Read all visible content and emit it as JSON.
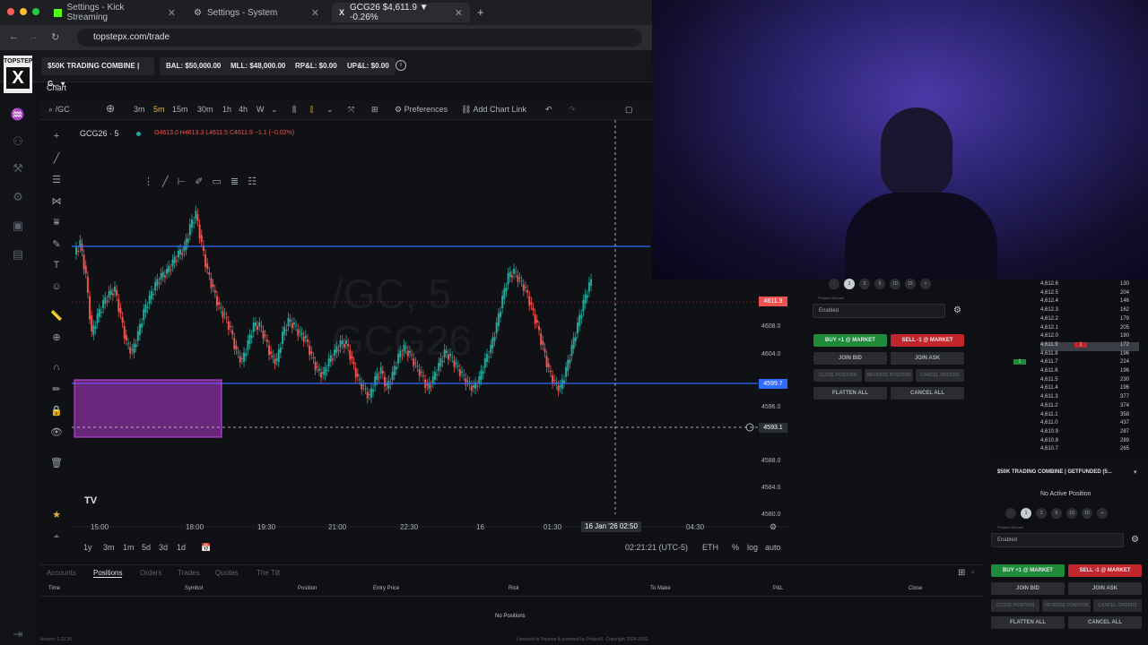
{
  "browser": {
    "tabs": [
      {
        "label": "Settings - Kick Streaming",
        "icon": "kick-icon"
      },
      {
        "label": "Settings - System",
        "icon": "gear-icon"
      },
      {
        "label": "GCG26 $4,611.9 ▼ -0.26%",
        "icon": "topstep-icon"
      }
    ],
    "url": "topstepx.com/trade"
  },
  "app": {
    "logo_top": "TOPSTEP",
    "logo_letter": "X",
    "account_select": "$50K TRADING COMBINE | G...",
    "bal": "BAL: $50,000.00",
    "mll": "MLL: $48,000.00",
    "rpl": "RP&L: $0.00",
    "upl": "UP&L: $0.00"
  },
  "chart_panel": {
    "label": "Chart",
    "symbol_search": "/GC",
    "timeframes": [
      "3m",
      "5m",
      "15m",
      "30m",
      "1h",
      "4h",
      "W"
    ],
    "active_timeframe": "5m",
    "preferences": "Preferences",
    "add_chart_link": "Add Chart Link",
    "legend_symbol": "GCG26 · 5",
    "legend_ohlc": "O4613.0 H4613.3 L4611.5 C4611.9 −1.1 (−0.02%)",
    "watermark_line1": "/GC, 5",
    "watermark_line2": "GCG26",
    "price_axis": [
      "4608.0",
      "4604.0",
      "4596.0",
      "4588.0",
      "4584.0",
      "4580.0"
    ],
    "price_tags": {
      "current": "4611.9",
      "blue": "4599.7",
      "crosshair": "4593.1"
    },
    "time_axis": [
      "15:00",
      "18:00",
      "19:30",
      "21:00",
      "22:30",
      "16",
      "01:30",
      "04:30"
    ],
    "crosshair_time": "16 Jan '26  02:50",
    "ranges": [
      "1y",
      "3m",
      "1m",
      "5d",
      "3d",
      "1d"
    ],
    "clock": "02:21:21 (UTC-5)",
    "session": "ETH",
    "pct": "%",
    "log": "log",
    "auto": "auto",
    "colors": {
      "up": "#26a69a",
      "down": "#ef5350",
      "level": "#2f6bff",
      "zone": "#b23ad1"
    }
  },
  "order_panel": {
    "qty_buttons": [
      "1",
      "3",
      "5",
      "10",
      "15"
    ],
    "bracket_label": "Position Bracket",
    "bracket_value": "Enabled",
    "buy_market": "BUY +1 @ MARKET",
    "sell_market": "SELL -1 @ MARKET",
    "join_bid": "JOIN BID",
    "join_ask": "JOIN ASK",
    "close_position": "CLOSE POSITION",
    "reverse_position": "REVERSE POSITION",
    "cancel_orders": "CANCEL ORDERS",
    "flatten_all": "FLATTEN ALL",
    "cancel_all": "CANCEL ALL"
  },
  "ladder": {
    "rows": [
      {
        "price": "4,612.6",
        "vol": "130",
        "bid": "",
        "ask": ""
      },
      {
        "price": "4,612.5",
        "vol": "204",
        "bid": "",
        "ask": ""
      },
      {
        "price": "4,612.4",
        "vol": "146",
        "bid": "",
        "ask": ""
      },
      {
        "price": "4,612.3",
        "vol": "162",
        "bid": "",
        "ask": ""
      },
      {
        "price": "4,612.2",
        "vol": "179",
        "bid": "",
        "ask": ""
      },
      {
        "price": "4,612.1",
        "vol": "205",
        "bid": "",
        "ask": ""
      },
      {
        "price": "4,612.0",
        "vol": "190",
        "bid": "",
        "ask": ""
      },
      {
        "price": "4,611.9",
        "vol": "172",
        "bid": "",
        "ask": "1"
      },
      {
        "price": "4,611.8",
        "vol": "196",
        "bid": "",
        "ask": ""
      },
      {
        "price": "4,611.7",
        "vol": "224",
        "bid": "1",
        "ask": ""
      },
      {
        "price": "4,611.6",
        "vol": "196",
        "bid": "",
        "ask": ""
      },
      {
        "price": "4,611.5",
        "vol": "230",
        "bid": "",
        "ask": ""
      },
      {
        "price": "4,611.4",
        "vol": "196",
        "bid": "",
        "ask": ""
      },
      {
        "price": "4,611.3",
        "vol": "377",
        "bid": "",
        "ask": ""
      },
      {
        "price": "4,611.2",
        "vol": "374",
        "bid": "",
        "ask": ""
      },
      {
        "price": "4,611.1",
        "vol": "358",
        "bid": "",
        "ask": ""
      },
      {
        "price": "4,611.0",
        "vol": "437",
        "bid": "",
        "ask": ""
      },
      {
        "price": "4,610.9",
        "vol": "287",
        "bid": "",
        "ask": ""
      },
      {
        "price": "4,610.8",
        "vol": "289",
        "bid": "",
        "ask": ""
      },
      {
        "price": "4,610.7",
        "vol": "265",
        "bid": "",
        "ask": ""
      }
    ]
  },
  "account2": {
    "title": "$50K TRADING COMBINE | GETFUNDED (5...",
    "no_position": "No Active Position"
  },
  "positions": {
    "tabs": [
      "Accounts",
      "Positions",
      "Orders",
      "Trades",
      "Quotes",
      "The Tilt"
    ],
    "active_tab": "Positions",
    "columns": [
      "Time",
      "Symbol",
      "Position",
      "Entry Price",
      "Risk",
      "To Make",
      "P&L",
      "Close"
    ],
    "empty": "No Positions"
  },
  "footer": "Licensed to Topstep & powered by ProjectX. Copyright 2024-2026",
  "version": "Version: 1.22.35"
}
